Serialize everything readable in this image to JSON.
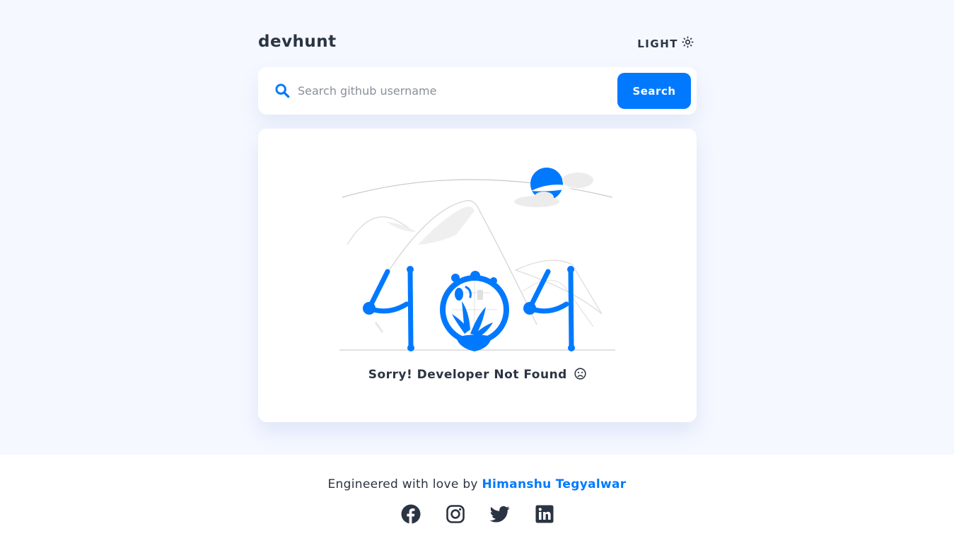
{
  "app": {
    "logo": "devhunt",
    "theme_toggle_label": "LIGHT",
    "theme_icon": "sun-icon"
  },
  "search": {
    "placeholder": "Search github username",
    "value": "",
    "button_label": "Search",
    "icon": "search-icon"
  },
  "result": {
    "illustration": "404-not-found-illustration",
    "message": "Sorry! Developer Not Found",
    "message_icon": "sad-face-icon"
  },
  "footer": {
    "credit_prefix": "Engineered with love by",
    "author_name": "Himanshu Tegyalwar",
    "socials": [
      {
        "icon": "facebook-icon"
      },
      {
        "icon": "instagram-icon"
      },
      {
        "icon": "twitter-icon"
      },
      {
        "icon": "linkedin-icon"
      }
    ]
  },
  "colors": {
    "accent": "#0079ff",
    "background": "#f5f8ff",
    "card": "#ffffff",
    "text": "#2b3442"
  }
}
